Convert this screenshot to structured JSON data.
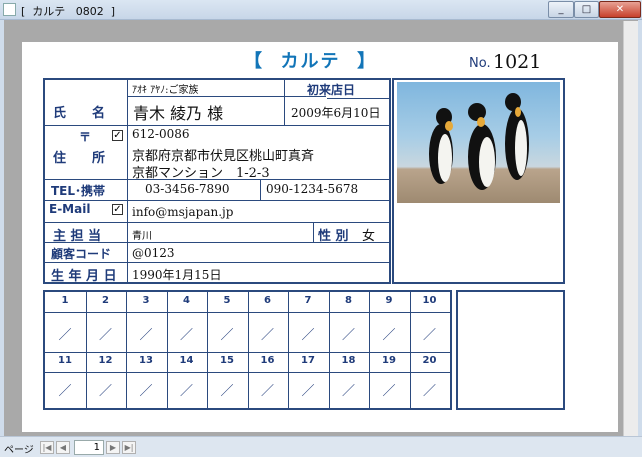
{
  "window": {
    "title": "[  カルテ   0802  ]"
  },
  "card": {
    "title": "【  カルテ  】",
    "no_label": "No.",
    "no_value": "1021"
  },
  "customer": {
    "furigana": "ｱｵｷ ｱﾔﾉ:ご家族",
    "name_label": "氏　　名",
    "name_value": "青木 綾乃 様",
    "first_visit_label": "初来店日",
    "first_visit_value": "2009年6月10日",
    "postal_symbol": "〒",
    "postal_checked": "✓",
    "postal_code": "612-0086",
    "address_label": "住　　所",
    "address_line1": "京都府京都市伏見区桃山町真斉",
    "address_line2": "京都マンション　1-2-3",
    "tel_label": "TEL･携帯",
    "tel_value": "03-3456-7890",
    "mobile_value": "090-1234-5678",
    "email_label": "E-Mail",
    "email_checked": "✓",
    "email_value": "info@msjapan.jp",
    "staff_label": "主 担 当",
    "staff_value": "青川",
    "gender_label": "性 別",
    "gender_value": "女",
    "code_label": "顧客コード",
    "code_value": "@0123",
    "birth_label": "生 年 月 日",
    "birth_value": "1990年1月15日"
  },
  "visits": [
    {
      "num": "1",
      "mark": "／"
    },
    {
      "num": "2",
      "mark": "／"
    },
    {
      "num": "3",
      "mark": "／"
    },
    {
      "num": "4",
      "mark": "／"
    },
    {
      "num": "5",
      "mark": "／"
    },
    {
      "num": "6",
      "mark": "／"
    },
    {
      "num": "7",
      "mark": "／"
    },
    {
      "num": "8",
      "mark": "／"
    },
    {
      "num": "9",
      "mark": "／"
    },
    {
      "num": "10",
      "mark": "／"
    },
    {
      "num": "11",
      "mark": "／"
    },
    {
      "num": "12",
      "mark": "／"
    },
    {
      "num": "13",
      "mark": "／"
    },
    {
      "num": "14",
      "mark": "／"
    },
    {
      "num": "15",
      "mark": "／"
    },
    {
      "num": "16",
      "mark": "／"
    },
    {
      "num": "17",
      "mark": "／"
    },
    {
      "num": "18",
      "mark": "／"
    },
    {
      "num": "19",
      "mark": "／"
    },
    {
      "num": "20",
      "mark": "／"
    }
  ],
  "statusbar": {
    "page_label": "ページ",
    "page_value": "1",
    "first_icon": "first-page-icon",
    "prev_icon": "prev-page-icon",
    "next_icon": "next-page-icon",
    "last_icon": "last-page-icon"
  },
  "colors": {
    "accent": "#1275b8",
    "frame": "#2b4a7e",
    "label": "#1f3b7a"
  }
}
